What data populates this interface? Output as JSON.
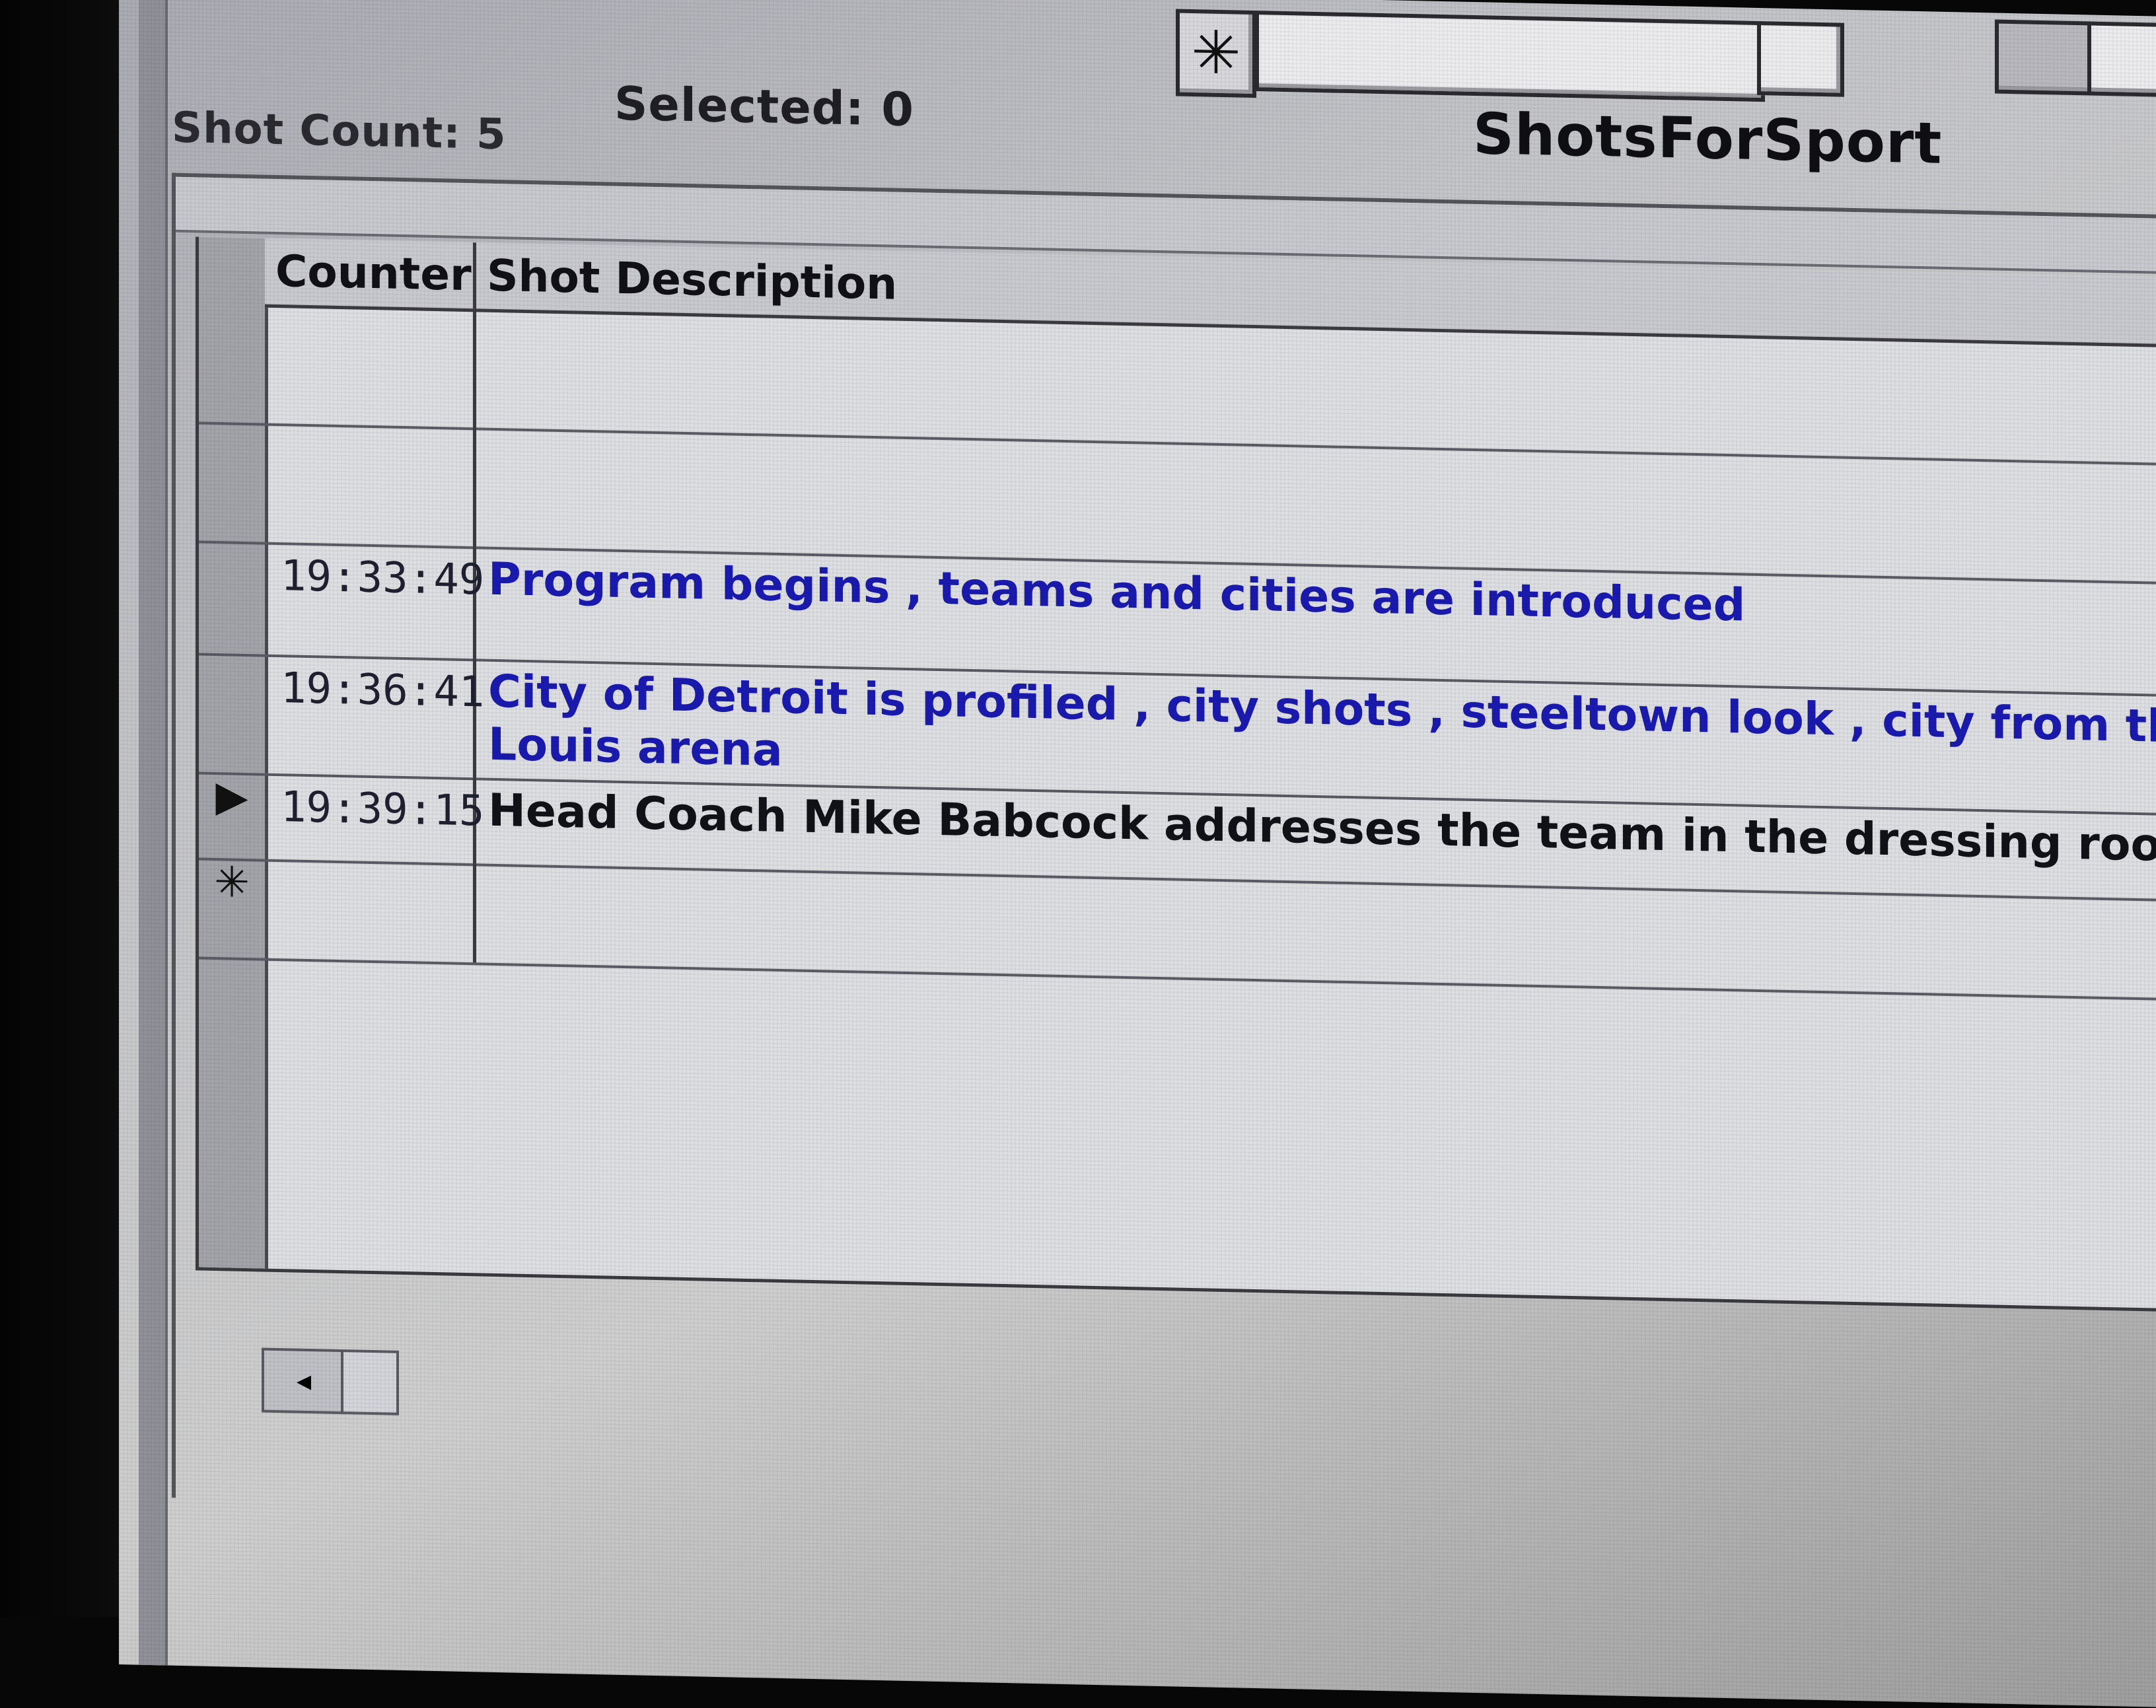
{
  "status": {
    "shot_count": "Shot Count: 5",
    "selected": "Selected: 0"
  },
  "app_title": "ShotsForSport",
  "toolbar": {
    "new_record_icon": "asterisk-icon",
    "new_record_glyph": "✳"
  },
  "table": {
    "columns": [
      "Counter",
      "Shot Description"
    ],
    "rows": [
      {
        "selector": "",
        "counter": "",
        "description": "",
        "description2": ""
      },
      {
        "selector": "",
        "counter": "",
        "description": "",
        "description2": ""
      },
      {
        "selector": "",
        "counter": "19:33:49",
        "description": "Program begins , teams and cities are introduced",
        "description2": ""
      },
      {
        "selector": "",
        "counter": "19:36:41",
        "description": "City of Detroit is profiled , city shots , steeltown look , city from the",
        "description2": "Louis arena"
      },
      {
        "selector": "▶",
        "counter": "19:39:15",
        "description": "Head Coach Mike Babcock addresses the team in the dressing roo",
        "description2": ""
      },
      {
        "selector": "✳",
        "counter": "",
        "description": "",
        "description2": ""
      }
    ]
  },
  "scrollbar": {
    "left_arrow": "◂"
  },
  "colors": {
    "description_text": "#1a1ab0",
    "active_text": "#111118",
    "grid_background": "#dedfe2"
  }
}
